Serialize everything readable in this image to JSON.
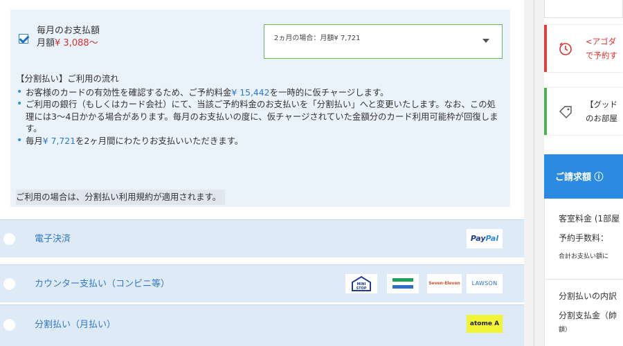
{
  "installment": {
    "monthly_title": "毎月のお支払額",
    "monthly_prefix": "月額",
    "monthly_amount": "¥ 3,088",
    "monthly_suffix": "～",
    "checkbox_checked": true,
    "plan_selected": "2ヵ月の場合：月額¥ 7,721",
    "flow_heading": "【分割払い】ご利用の流れ",
    "flow_items": [
      {
        "before": "お客様のカードの有効性を確認するため、ご予約料金",
        "amount": "¥ 15,442",
        "after": "を一時的に仮チャージします。"
      },
      {
        "before": "ご利用の銀行（もしくはカード会社）にて、当該ご予約料金のお支払いを「分割払い」へと変更いたします。なお、この処理には3～4日かかる場合があります。毎月のお支払いの度に、仮チャージされていた金額分のカード利用可能枠が回復します。",
        "amount": "",
        "after": ""
      },
      {
        "before": "毎月",
        "amount": "¥ 7,721",
        "after": "を2ヶ月間にわたりお支払いいただきます。"
      }
    ],
    "terms_note": "ご利用の場合は、分割払い利用規約が適用されます。"
  },
  "payment_options": [
    {
      "label": "電子決済",
      "logos": [
        "PayPal"
      ]
    },
    {
      "label": "カウンター支払い（コンビニ等）",
      "logos": [
        "MINI STOP",
        "FamilyMart",
        "Seven-Eleven",
        "LAWSON"
      ]
    },
    {
      "label": "分割払い（月払い）",
      "logos": [
        "atome A"
      ]
    }
  ],
  "logos": {
    "paypal_a": "Pay",
    "paypal_b": "Pal",
    "ministop": "MINI STOP",
    "seven": "Seven-Eleven",
    "lawson": "LAWSON",
    "atome": "atome A"
  },
  "sidebar": {
    "alert_red_line1": "<アゴダ",
    "alert_red_line2": "で予約す",
    "alert_green_line1": "【グッド",
    "alert_green_line2": "のお部屋",
    "billing_title": "ご請求額 ⓘ",
    "room_fee": "客室料金 (1部屋",
    "booking_fee": "予約手数料：",
    "total_note": "合計お支払い額に",
    "installment_breakdown": "分割払いの内訳",
    "installment_amount": "分割支払金（帥",
    "installment_tail": "額）"
  },
  "colors": {
    "accent_blue": "#2a8be0",
    "amount_red": "#d9302b",
    "panel_bg": "#eaf2fb",
    "select_border": "#69b35a",
    "alert_red": "#e0403a",
    "alert_green": "#4caf50"
  }
}
